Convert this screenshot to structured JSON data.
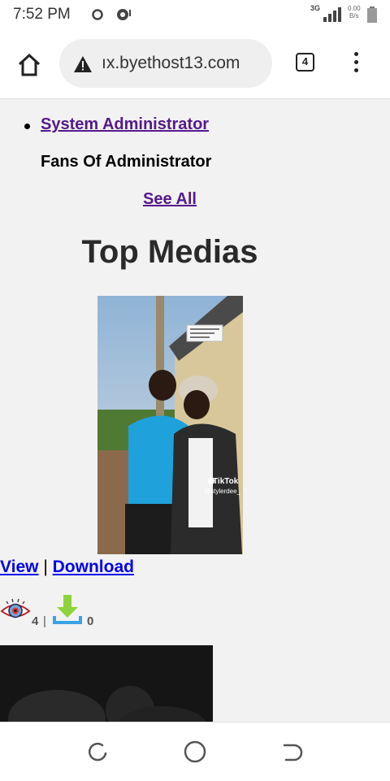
{
  "status_bar": {
    "time": "7:52 PM",
    "network": "3G",
    "speed_value": "0.00",
    "speed_unit": "B/s"
  },
  "browser": {
    "url": "ıx.byethost13.com",
    "tab_count": "4"
  },
  "page": {
    "admin_link": "System Administrator",
    "fans_label": "Fans Of Administrator",
    "see_all": "See All",
    "section_title": "Top Medias",
    "media_item": {
      "view_label": "View",
      "separator": "|",
      "download_label": "Download",
      "views": "4",
      "stats_separator": "|",
      "downloads": "0",
      "watermark_brand": "TikTok",
      "watermark_handle": "@stylerdee_"
    }
  },
  "colors": {
    "visited_link": "#551a8b",
    "link": "#0000ee",
    "page_bg": "#f2f2f2"
  },
  "icons": {
    "home": "home-icon",
    "warning": "warning-icon",
    "menu": "more-vert-icon",
    "eye": "eye-icon",
    "download": "download-icon"
  }
}
